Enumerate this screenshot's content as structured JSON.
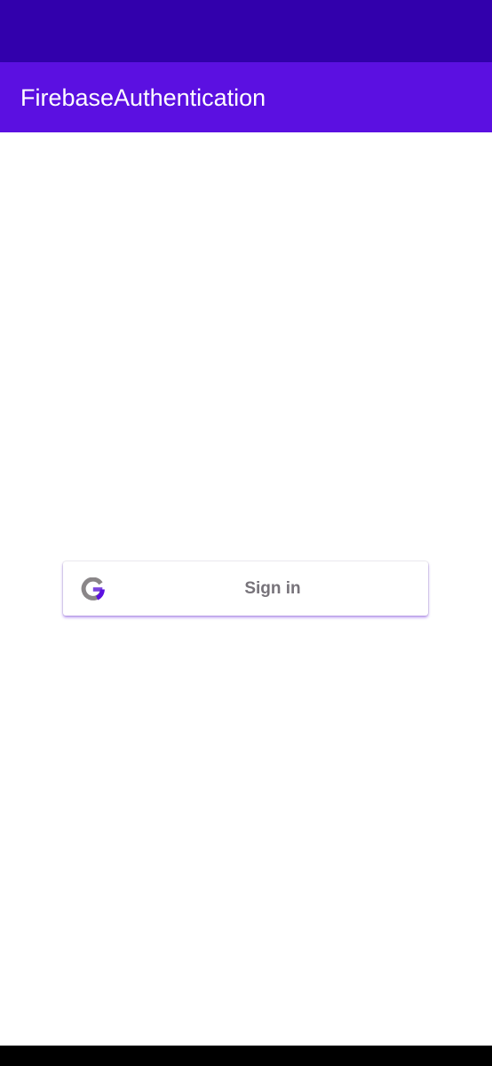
{
  "status_bar": {
    "color": "#3200ac"
  },
  "app_bar": {
    "title": "FirebaseAuthentication",
    "color": "#5b10e1"
  },
  "signin": {
    "label": "Sign in",
    "icon": "google-icon"
  },
  "nav_bar": {
    "color": "#000000"
  }
}
